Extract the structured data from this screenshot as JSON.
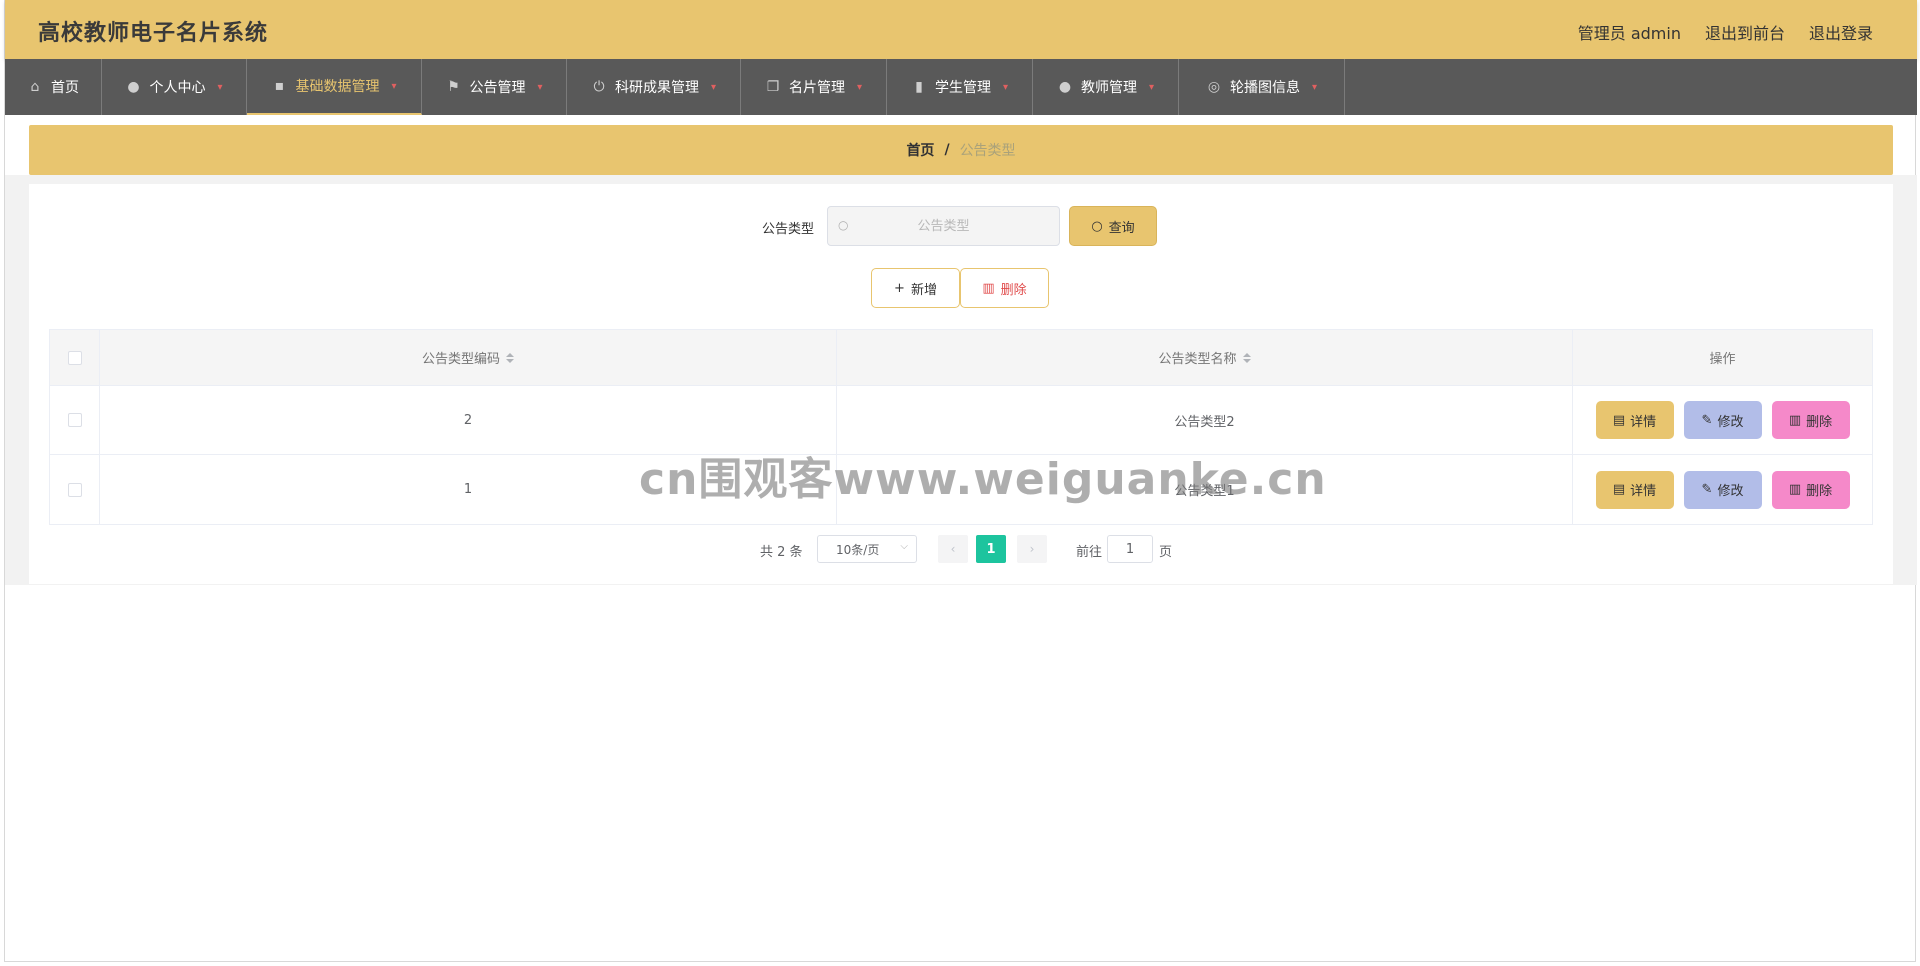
{
  "header": {
    "app_title": "高校教师电子名片系统",
    "admin_label": "管理员 admin",
    "to_frontend": "退出到前台",
    "logout": "退出登录"
  },
  "nav": {
    "items": [
      {
        "label": "首页",
        "icon": "home-icon"
      },
      {
        "label": "个人中心",
        "icon": "user-icon"
      },
      {
        "label": "基础数据管理",
        "icon": "chat-icon",
        "active": true
      },
      {
        "label": "公告管理",
        "icon": "flag-icon"
      },
      {
        "label": "科研成果管理",
        "icon": "power-icon"
      },
      {
        "label": "名片管理",
        "icon": "copy-icon"
      },
      {
        "label": "学生管理",
        "icon": "clipboard-icon"
      },
      {
        "label": "教师管理",
        "icon": "user-icon"
      },
      {
        "label": "轮播图信息",
        "icon": "target-icon"
      }
    ]
  },
  "breadcrumb": {
    "home": "首页",
    "separator": "/",
    "current": "公告类型"
  },
  "search": {
    "label": "公告类型",
    "placeholder": "公告类型",
    "button": "查询"
  },
  "actions": {
    "add": "新增",
    "delete": "删除"
  },
  "table": {
    "columns": [
      "公告类型编码",
      "公告类型名称",
      "操作"
    ],
    "rows": [
      {
        "code": "2",
        "name": "公告类型2"
      },
      {
        "code": "1",
        "name": "公告类型1"
      }
    ],
    "row_actions": {
      "detail": "详情",
      "edit": "修改",
      "delete": "删除"
    }
  },
  "pagination": {
    "total": "共 2 条",
    "page_size": "10条/页",
    "current_page": "1",
    "goto_label": "前往",
    "goto_value": "1",
    "page_suffix": "页"
  },
  "watermark": "cn围观客www.weiguanke.cn",
  "colors": {
    "accent": "#e8c56f",
    "nav_bg": "#595959",
    "pager_active": "#1dc49e",
    "edit_btn": "#b2bde8",
    "delete_btn": "#f589c9"
  }
}
